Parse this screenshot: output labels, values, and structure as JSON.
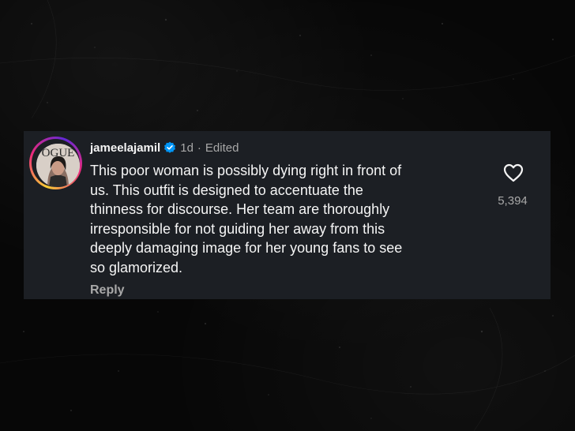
{
  "comment": {
    "username": "jameelajamil",
    "verified": true,
    "time_ago": "1d",
    "separator": "·",
    "edited_label": "Edited",
    "text_lines": [
      "This poor woman is possibly dying right in front of",
      "us. This outfit is designed to accentuate the",
      "thinness for discourse. Her team are thoroughly",
      "irresponsible for not guiding her away from this",
      "deeply damaging image for her young fans to see",
      "so glamorized."
    ],
    "like_count": "5,394",
    "reply_label": "Reply",
    "avatar_text": "OGUE"
  },
  "colors": {
    "card_bg": "#1c1f24",
    "primary_text": "#f5f5f5",
    "secondary_text": "#a8a8a8",
    "verified_blue": "#0095f6",
    "story_ring": [
      "#f9ce34",
      "#ee2a7b",
      "#6228d7"
    ]
  },
  "icons": {
    "like": "heart-outline-icon",
    "verified": "verified-badge-icon"
  }
}
